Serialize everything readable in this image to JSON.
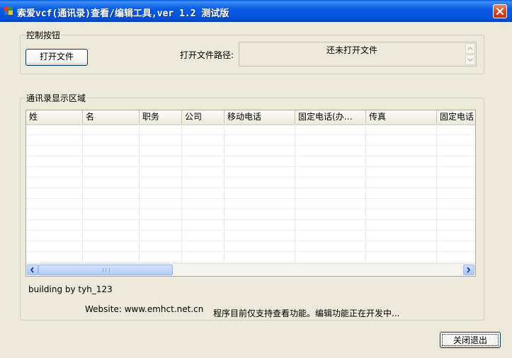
{
  "window": {
    "title": "索爱vcf(通讯录)查看/编辑工具,ver 1.2 测试版"
  },
  "control_group": {
    "legend": "控制按钮",
    "open_button": "打开文件",
    "path_label": "打开文件路径:",
    "path_value": "还未打开文件"
  },
  "contacts_group": {
    "legend": "通讯录显示区域",
    "columns": [
      "姓",
      "名",
      "职务",
      "公司",
      "移动电话",
      "固定电话(办…",
      "传真",
      "固定电话"
    ]
  },
  "footer": {
    "credit": "building by tyh_123",
    "website": "Website: www.emhct.net.cn",
    "notice": "程序目前仅支持查看功能。编辑功能正在开发中...",
    "exit_button": "关闭退出"
  },
  "icons": {
    "app": "app-icon",
    "close": "close-icon"
  }
}
